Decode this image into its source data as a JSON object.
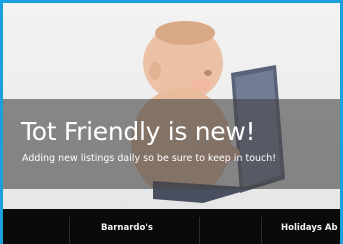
{
  "hero": {
    "headline": "Tot Friendly is new!",
    "subline": "Adding new listings daily so be sure to keep in touch!",
    "image_subject": "baby-with-laptop"
  },
  "nav": {
    "items": [
      {
        "label": "Barnardo's"
      },
      {
        "label": "Holidays Ab"
      }
    ]
  },
  "colors": {
    "frame_border": "#1aa0dc",
    "nav_background": "#0a0a0a",
    "overlay": "rgba(70,70,70,0.62)"
  }
}
